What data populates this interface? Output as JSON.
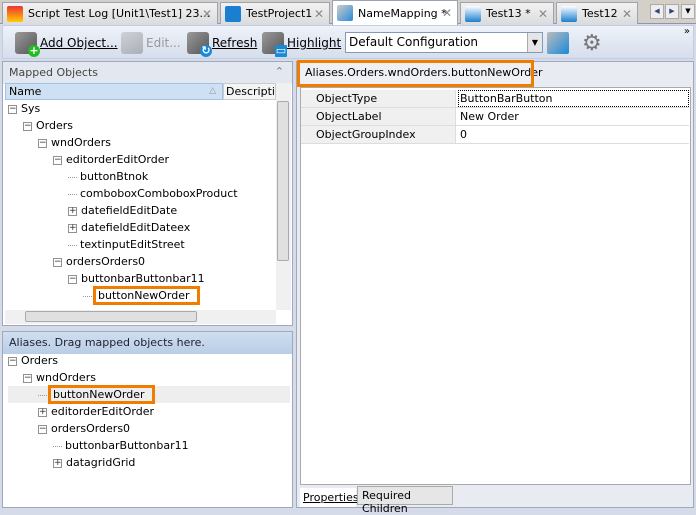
{
  "tabs": [
    {
      "label": "Script Test Log [Unit1\\Test1] 23...",
      "icon": "test-log-icon",
      "active": false
    },
    {
      "label": "TestProject1",
      "icon": "project-icon",
      "active": false
    },
    {
      "label": "NameMapping *",
      "icon": "name-mapping-icon",
      "active": true
    },
    {
      "label": "Test13 *",
      "icon": "test-key-icon",
      "active": false
    },
    {
      "label": "Test12",
      "icon": "test-key-icon",
      "active": false
    }
  ],
  "toolbar": {
    "add_object": "Add Object...",
    "edit": "Edit...",
    "refresh": "Refresh",
    "highlight": "Highlight",
    "configuration": "Default Configuration"
  },
  "mapped": {
    "title": "Mapped Objects",
    "col_name": "Name",
    "col_desc": "Description",
    "items": [
      {
        "label": "Sys",
        "level": 0,
        "toggle": "-"
      },
      {
        "label": "Orders",
        "level": 1,
        "toggle": "-"
      },
      {
        "label": "wndOrders",
        "level": 2,
        "toggle": "-"
      },
      {
        "label": "editorderEditOrder",
        "level": 3,
        "toggle": "-"
      },
      {
        "label": "buttonBtnok",
        "level": 4,
        "toggle": ""
      },
      {
        "label": "comboboxComboboxProduct",
        "level": 4,
        "toggle": ""
      },
      {
        "label": "datefieldEditDate",
        "level": 4,
        "toggle": "+"
      },
      {
        "label": "datefieldEditDateex",
        "level": 4,
        "toggle": "+"
      },
      {
        "label": "textinputEditStreet",
        "level": 4,
        "toggle": ""
      },
      {
        "label": "ordersOrders0",
        "level": 3,
        "toggle": "-"
      },
      {
        "label": "buttonbarButtonbar11",
        "level": 4,
        "toggle": "-"
      },
      {
        "label": "buttonNewOrder",
        "level": 5,
        "toggle": "",
        "highlight": true
      }
    ]
  },
  "aliases": {
    "title": "Aliases. Drag mapped objects here.",
    "items": [
      {
        "label": "Orders",
        "level": 0,
        "toggle": "-"
      },
      {
        "label": "wndOrders",
        "level": 1,
        "toggle": "-"
      },
      {
        "label": "buttonNewOrder",
        "level": 2,
        "toggle": "",
        "highlight": true,
        "selected": true
      },
      {
        "label": "editorderEditOrder",
        "level": 2,
        "toggle": "+"
      },
      {
        "label": "ordersOrders0",
        "level": 2,
        "toggle": "-"
      },
      {
        "label": "buttonbarButtonbar11",
        "level": 3,
        "toggle": ""
      },
      {
        "label": "datagridGrid",
        "level": 3,
        "toggle": "+"
      }
    ]
  },
  "details": {
    "path": "Aliases.Orders.wndOrders.buttonNewOrder",
    "properties": [
      {
        "name": "ObjectType",
        "value": "ButtonBarButton"
      },
      {
        "name": "ObjectLabel",
        "value": "New Order"
      },
      {
        "name": "ObjectGroupIndex",
        "value": "0"
      }
    ],
    "tabs": [
      "Properties",
      "Required Children"
    ]
  },
  "colors": {
    "highlight": "#f07d00",
    "header": "#cfe0f3"
  }
}
